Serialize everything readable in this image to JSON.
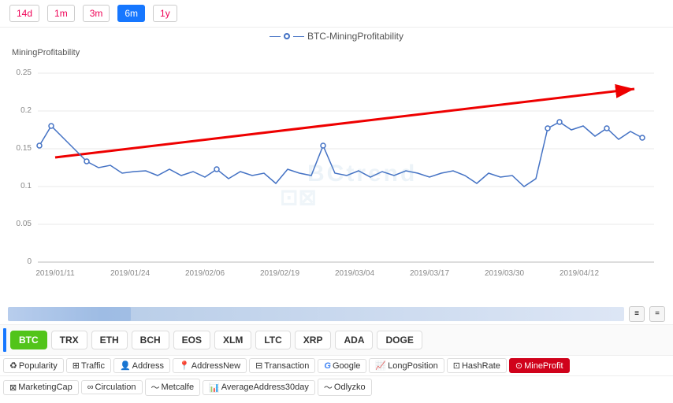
{
  "timeButtons": [
    "14d",
    "1m",
    "3m",
    "6m",
    "1y"
  ],
  "activeTime": "6m",
  "chartTitle": "BTC-MiningProfitability",
  "yAxisLabel": "MiningProfitability",
  "yAxisValues": [
    "0.25",
    "0.2",
    "0.15",
    "0.1",
    "0.05",
    "0"
  ],
  "xAxisDates": [
    "2019/01/11",
    "2019/01/24",
    "2019/02/06",
    "2019/02/19",
    "2019/03/04",
    "2019/03/17",
    "2019/03/30",
    "2019/04/12"
  ],
  "watermark": "BCtrend",
  "coins": [
    "BTC",
    "TRX",
    "ETH",
    "BCH",
    "EOS",
    "XLM",
    "LTC",
    "XRP",
    "ADA",
    "DOGE"
  ],
  "activeCoin": "BTC",
  "metrics1": [
    {
      "icon": "♻",
      "label": "Popularity"
    },
    {
      "icon": "⊞",
      "label": "Traffic"
    },
    {
      "icon": "👤",
      "label": "Address"
    },
    {
      "icon": "📍",
      "label": "AddressNew"
    },
    {
      "icon": "⊟",
      "label": "Transaction"
    },
    {
      "icon": "G",
      "label": "Google"
    },
    {
      "icon": "📈",
      "label": "LongPosition"
    },
    {
      "icon": "⊡",
      "label": "HashRate"
    },
    {
      "icon": "⊙",
      "label": "MineProfit"
    }
  ],
  "metrics2": [
    {
      "icon": "⊠",
      "label": "MarketingCap"
    },
    {
      "icon": "∞",
      "label": "Circulation"
    },
    {
      "icon": "〜",
      "label": "Metcalfe"
    },
    {
      "icon": "📊",
      "label": "AverageAddress30day"
    },
    {
      "icon": "〜",
      "label": "Odlyzko"
    }
  ],
  "miniControls": [
    "≡",
    "="
  ]
}
